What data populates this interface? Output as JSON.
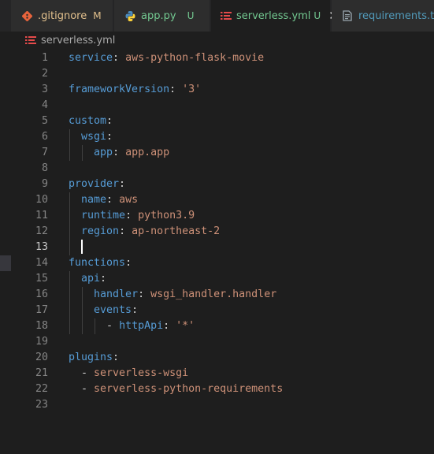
{
  "tabs": [
    {
      "label": ".gitignore",
      "status": "M",
      "icon": "git-icon",
      "status_color": "#e2c08d",
      "label_color": "#e2c08d"
    },
    {
      "label": "app.py",
      "status": "U",
      "icon": "python-icon",
      "status_color": "#73c991",
      "label_color": "#73c991"
    },
    {
      "label": "serverless.yml",
      "status": "U",
      "icon": "yaml-icon",
      "status_color": "#73c991",
      "label_color": "#73c991",
      "active": true,
      "close": "✕"
    },
    {
      "label": "requirements.tx",
      "icon": "text-file-icon",
      "label_color": "#519aba"
    }
  ],
  "breadcrumb": {
    "file": "serverless.yml"
  },
  "editor": {
    "current_line": 13,
    "lines": [
      {
        "n": "1",
        "key": "service",
        "sep": ": ",
        "val": "aws-python-flask-movie"
      },
      {
        "n": "2"
      },
      {
        "n": "3",
        "key": "frameworkVersion",
        "sep": ": ",
        "val": "'3'"
      },
      {
        "n": "4"
      },
      {
        "n": "5",
        "key": "custom",
        "sep": ":"
      },
      {
        "n": "6",
        "indent": "  ",
        "key": "wsgi",
        "sep": ":"
      },
      {
        "n": "7",
        "indent": "    ",
        "key": "app",
        "sep": ": ",
        "val": "app.app"
      },
      {
        "n": "8"
      },
      {
        "n": "9",
        "key": "provider",
        "sep": ":"
      },
      {
        "n": "10",
        "indent": "  ",
        "key": "name",
        "sep": ": ",
        "val": "aws"
      },
      {
        "n": "11",
        "indent": "  ",
        "key": "runtime",
        "sep": ": ",
        "val": "python3.9"
      },
      {
        "n": "12",
        "indent": "  ",
        "key": "region",
        "sep": ": ",
        "val": "ap-northeast-2"
      },
      {
        "n": "13",
        "indent": "  "
      },
      {
        "n": "14",
        "key": "functions",
        "sep": ":"
      },
      {
        "n": "15",
        "indent": "  ",
        "key": "api",
        "sep": ":"
      },
      {
        "n": "16",
        "indent": "    ",
        "key": "handler",
        "sep": ": ",
        "val": "wsgi_handler.handler"
      },
      {
        "n": "17",
        "indent": "    ",
        "key": "events",
        "sep": ":"
      },
      {
        "n": "18",
        "indent": "      ",
        "dash": "- ",
        "key": "httpApi",
        "sep": ": ",
        "val": "'*'"
      },
      {
        "n": "19"
      },
      {
        "n": "20",
        "key": "plugins",
        "sep": ":"
      },
      {
        "n": "21",
        "indent": "  ",
        "dash": "- ",
        "val": "serverless-wsgi"
      },
      {
        "n": "22",
        "indent": "  ",
        "dash": "- ",
        "val": "serverless-python-requirements"
      },
      {
        "n": "23"
      }
    ]
  },
  "colors": {
    "key": "#569cd6",
    "string": "#ce9178",
    "punct": "#d4d4d4",
    "line_number": "#858585",
    "background": "#1e1e1e"
  }
}
